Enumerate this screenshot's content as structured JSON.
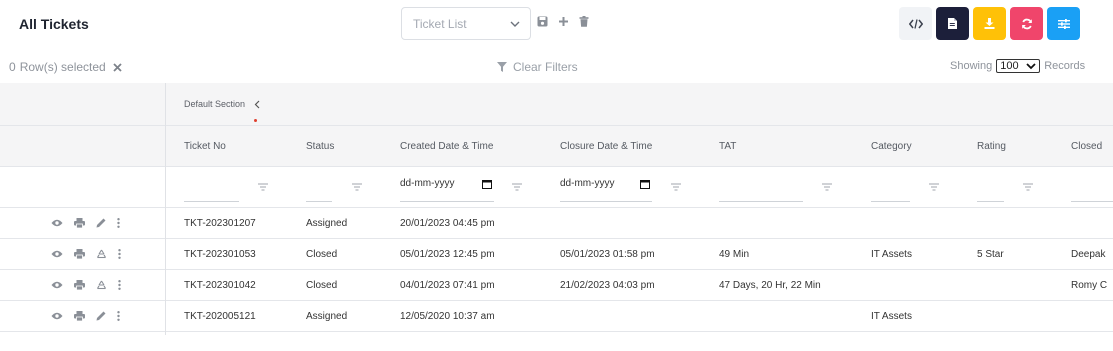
{
  "header": {
    "title": "All Tickets",
    "view_selector": "Ticket List"
  },
  "toolbar": {
    "buttons": [
      {
        "name": "embed-code-button",
        "icon": "code-icon",
        "color": "#f1f3f6"
      },
      {
        "name": "pdf-export-button",
        "icon": "document-icon",
        "color": "#1c1f3a"
      },
      {
        "name": "download-button",
        "icon": "download-icon",
        "color": "#ffc107"
      },
      {
        "name": "refresh-button",
        "icon": "refresh-icon",
        "color": "#f0456b"
      },
      {
        "name": "column-settings-button",
        "icon": "sliders-icon",
        "color": "#1aa0f5"
      }
    ]
  },
  "selection": {
    "count": "0",
    "label": "Row(s) selected"
  },
  "filters": {
    "clear_label": "Clear Filters",
    "date_placeholder": "dd-mm-yyyy"
  },
  "paging": {
    "showing_label": "Showing",
    "page_size": "100",
    "records_label": "Records"
  },
  "section": {
    "label": "Default Section"
  },
  "columns": [
    "Ticket No",
    "Status",
    "Created Date & Time",
    "Closure Date & Time",
    "TAT",
    "Category",
    "Rating",
    "Closed"
  ],
  "rows": [
    {
      "ticket_no": "TKT-202301207",
      "status": "Assigned",
      "created": "20/01/2023 04:45 pm",
      "closure": "",
      "tat": "",
      "category": "",
      "rating": "",
      "closed_by": "",
      "third_icon": "edit"
    },
    {
      "ticket_no": "TKT-202301053",
      "status": "Closed",
      "created": "05/01/2023 12:45 pm",
      "closure": "05/01/2023 01:58 pm",
      "tat": "49 Min",
      "category": "IT Assets",
      "rating": "5 Star",
      "closed_by": "Deepak",
      "third_icon": "recycle"
    },
    {
      "ticket_no": "TKT-202301042",
      "status": "Closed",
      "created": "04/01/2023 07:41 pm",
      "closure": "21/02/2023 04:03 pm",
      "tat": "47 Days, 20 Hr, 22 Min",
      "category": "",
      "rating": "",
      "closed_by": "Romy C",
      "third_icon": "recycle"
    },
    {
      "ticket_no": "TKT-202005121",
      "status": "Assigned",
      "created": "12/05/2020 10:37 am",
      "closure": "",
      "tat": "",
      "category": "IT Assets",
      "rating": "",
      "closed_by": "",
      "third_icon": "edit"
    }
  ]
}
